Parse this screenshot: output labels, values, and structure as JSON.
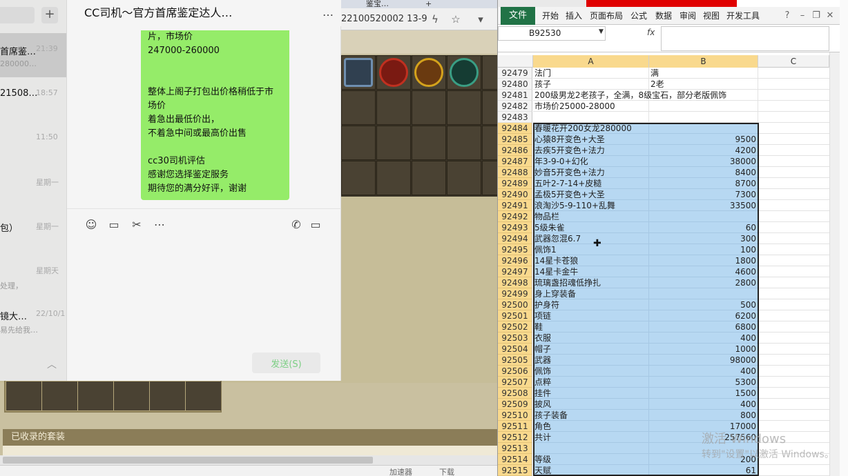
{
  "browser": {
    "tab_label": "鉴宝…",
    "url_fragment": "22100520002‌13-9",
    "url_text": "22100520002 13-9"
  },
  "game": {
    "set_header": "已收录的套装",
    "status_items": [
      "加速器",
      "下载"
    ]
  },
  "wechat": {
    "conversations": [
      {
        "title": "首席鉴…",
        "time": "21:39",
        "sub": "280000…",
        "active": true
      },
      {
        "title": "21508…",
        "time": "18:57",
        "sub": "",
        "active": false
      },
      {
        "title": "",
        "time": "11:50",
        "sub": "",
        "active": false
      },
      {
        "title": "",
        "time": "星期一",
        "sub": "",
        "active": false
      },
      {
        "title": "包）",
        "time": "星期一",
        "sub": "",
        "active": false
      },
      {
        "title": "",
        "time": "星期天",
        "sub": "处理，",
        "active": false
      },
      {
        "title": "镜大…",
        "time": "22/10/1",
        "sub": "易先给我…",
        "active": false
      }
    ],
    "chat": {
      "title": "CC司机～官方首席鉴定达人…",
      "more": "…",
      "bubble_lines": [
        "片，市场价",
        "247000-260000",
        "",
        "",
        "整体上阁子打包出价格稍低于市",
        "场价",
        "着急出最低价出，",
        "不着急中间或最高价出售",
        "",
        "cc30司机评估",
        "感谢您选择鉴定服务",
        "期待您的满分好评，谢谢"
      ],
      "send_label": "发送(S)"
    }
  },
  "excel": {
    "ribbon_tabs": [
      "开始",
      "插入",
      "页面布局",
      "公式",
      "数据",
      "审阅",
      "视图",
      "开发工具"
    ],
    "file_tab": "文件",
    "name_box": "B92530",
    "fx": "fx",
    "col_headers": [
      "A",
      "B",
      "C"
    ],
    "rows": [
      {
        "n": "92479",
        "a": "法门",
        "b": "满",
        "btxt": true,
        "sel": false
      },
      {
        "n": "92480",
        "a": "孩子",
        "b": "2老",
        "btxt": true,
        "sel": false
      },
      {
        "n": "92481",
        "a": "200级男龙2老孩子，全满，8级宝石，部分老版佩饰",
        "b": "",
        "btxt": false,
        "sel": false
      },
      {
        "n": "92482",
        "a": "市场价25000-28000",
        "b": "",
        "btxt": false,
        "sel": false
      },
      {
        "n": "92483",
        "a": "",
        "b": "",
        "btxt": false,
        "sel": false
      },
      {
        "n": "92484",
        "a": "春暖花开200女龙280000",
        "b": "",
        "btxt": false,
        "sel": true
      },
      {
        "n": "92485",
        "a": "心猿8开变色+大圣",
        "b": "9500",
        "btxt": false,
        "sel": true
      },
      {
        "n": "92486",
        "a": "去疾5开变色+法力",
        "b": "4200",
        "btxt": false,
        "sel": true
      },
      {
        "n": "92487",
        "a": "年3-9-0+幻化",
        "b": "38000",
        "btxt": false,
        "sel": true
      },
      {
        "n": "92488",
        "a": "妙音5开变色+法力",
        "b": "8400",
        "btxt": false,
        "sel": true
      },
      {
        "n": "92489",
        "a": "五叶2-7-14+皮糙",
        "b": "8700",
        "btxt": false,
        "sel": true
      },
      {
        "n": "92490",
        "a": "孟极5开变色+大圣",
        "b": "7300",
        "btxt": false,
        "sel": true
      },
      {
        "n": "92491",
        "a": "浪淘沙5-9-110+乱舞",
        "b": "33500",
        "btxt": false,
        "sel": true
      },
      {
        "n": "92492",
        "a": "物品栏",
        "b": "",
        "btxt": false,
        "sel": true
      },
      {
        "n": "92493",
        "a": "5级朱雀",
        "b": "60",
        "btxt": false,
        "sel": true
      },
      {
        "n": "92494",
        "a": "武器忽混6.7",
        "b": "300",
        "btxt": false,
        "sel": true
      },
      {
        "n": "92495",
        "a": "佩饰1",
        "b": "100",
        "btxt": false,
        "sel": true
      },
      {
        "n": "92496",
        "a": "14星卡苍狼",
        "b": "1800",
        "btxt": false,
        "sel": true
      },
      {
        "n": "92497",
        "a": "14星卡金牛",
        "b": "4600",
        "btxt": false,
        "sel": true
      },
      {
        "n": "92498",
        "a": "琉璃盏招魂低挣扎",
        "b": "2800",
        "btxt": false,
        "sel": true
      },
      {
        "n": "92499",
        "a": "身上穿装备",
        "b": "",
        "btxt": false,
        "sel": true
      },
      {
        "n": "92500",
        "a": "护身符",
        "b": "500",
        "btxt": false,
        "sel": true
      },
      {
        "n": "92501",
        "a": "项链",
        "b": "6200",
        "btxt": false,
        "sel": true
      },
      {
        "n": "92502",
        "a": "鞋",
        "b": "6800",
        "btxt": false,
        "sel": true
      },
      {
        "n": "92503",
        "a": "衣服",
        "b": "400",
        "btxt": false,
        "sel": true
      },
      {
        "n": "92504",
        "a": "帽子",
        "b": "1000",
        "btxt": false,
        "sel": true
      },
      {
        "n": "92505",
        "a": "武器",
        "b": "98000",
        "btxt": false,
        "sel": true
      },
      {
        "n": "92506",
        "a": "佩饰",
        "b": "400",
        "btxt": false,
        "sel": true
      },
      {
        "n": "92507",
        "a": "点粹",
        "b": "5300",
        "btxt": false,
        "sel": true
      },
      {
        "n": "92508",
        "a": "挂件",
        "b": "1500",
        "btxt": false,
        "sel": true
      },
      {
        "n": "92509",
        "a": "披风",
        "b": "400",
        "btxt": false,
        "sel": true
      },
      {
        "n": "92510",
        "a": "孩子装备",
        "b": "800",
        "btxt": false,
        "sel": true
      },
      {
        "n": "92511",
        "a": "角色",
        "b": "17000",
        "btxt": false,
        "sel": true
      },
      {
        "n": "92512",
        "a": "共计",
        "b": "257560",
        "btxt": false,
        "sel": true
      },
      {
        "n": "92513",
        "a": "",
        "b": "",
        "btxt": false,
        "sel": true
      },
      {
        "n": "92514",
        "a": "等级",
        "b": "200",
        "btxt": false,
        "sel": true
      },
      {
        "n": "92515",
        "a": "天赋",
        "b": "61",
        "btxt": false,
        "sel": true
      }
    ]
  },
  "watermark": {
    "line1": "激活 Windows",
    "line2": "转到\"设置\"以激活 Windows。"
  },
  "colors": {
    "wechat_bubble": "#95ec69",
    "excel_green": "#217346",
    "selection_fill": "#b7d8f2",
    "header_highlight": "#f9d98d"
  }
}
